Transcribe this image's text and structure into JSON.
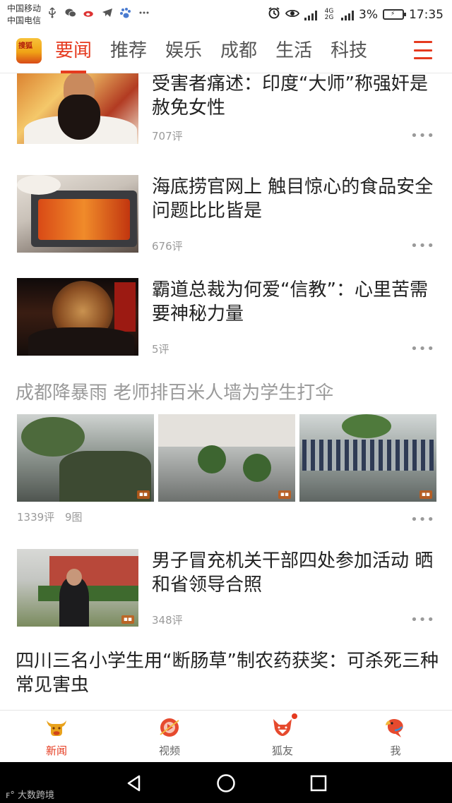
{
  "status_bar": {
    "carrier_1": "中国移动",
    "carrier_2": "中国电信",
    "net_badge": "4G 2G",
    "battery": "3%",
    "time": "17:35"
  },
  "tabs": {
    "logo_text": "搜狐",
    "items": [
      "要闻",
      "推荐",
      "娱乐",
      "成都",
      "生活",
      "科技"
    ],
    "active_index": 0,
    "accent_color": "#e53a1f"
  },
  "feed": {
    "items": [
      {
        "title": "受害者痛述：印度“大师”称强奸是赦免女性",
        "meta": "707评"
      },
      {
        "title": "海底捞官网上 触目惊心的食品安全问题比比皆是",
        "meta": "676评"
      },
      {
        "title": "霸道总裁为何爱“信教”：心里苦需要神秘力量",
        "meta": "5评"
      }
    ],
    "gallery_post": {
      "title": "成都降暴雨 老师排百米人墙为学生打伞",
      "comments": "1339评",
      "photos": "9图"
    },
    "item_4": {
      "title": "男子冒充机关干部四处参加活动 晒和省领导合照",
      "meta": "348评"
    },
    "item_5": {
      "title": "四川三名小学生用“断肠草”制农药获奖：可杀死三种常见害虫"
    },
    "more_glyph": "•••"
  },
  "bottom_nav": {
    "items": [
      {
        "label": "新闻",
        "icon": "bull-icon"
      },
      {
        "label": "视频",
        "icon": "video-icon"
      },
      {
        "label": "狐友",
        "icon": "fox-icon"
      },
      {
        "label": "我",
        "icon": "parrot-icon"
      }
    ],
    "active_index": 0
  },
  "watermark": "大数跨境"
}
